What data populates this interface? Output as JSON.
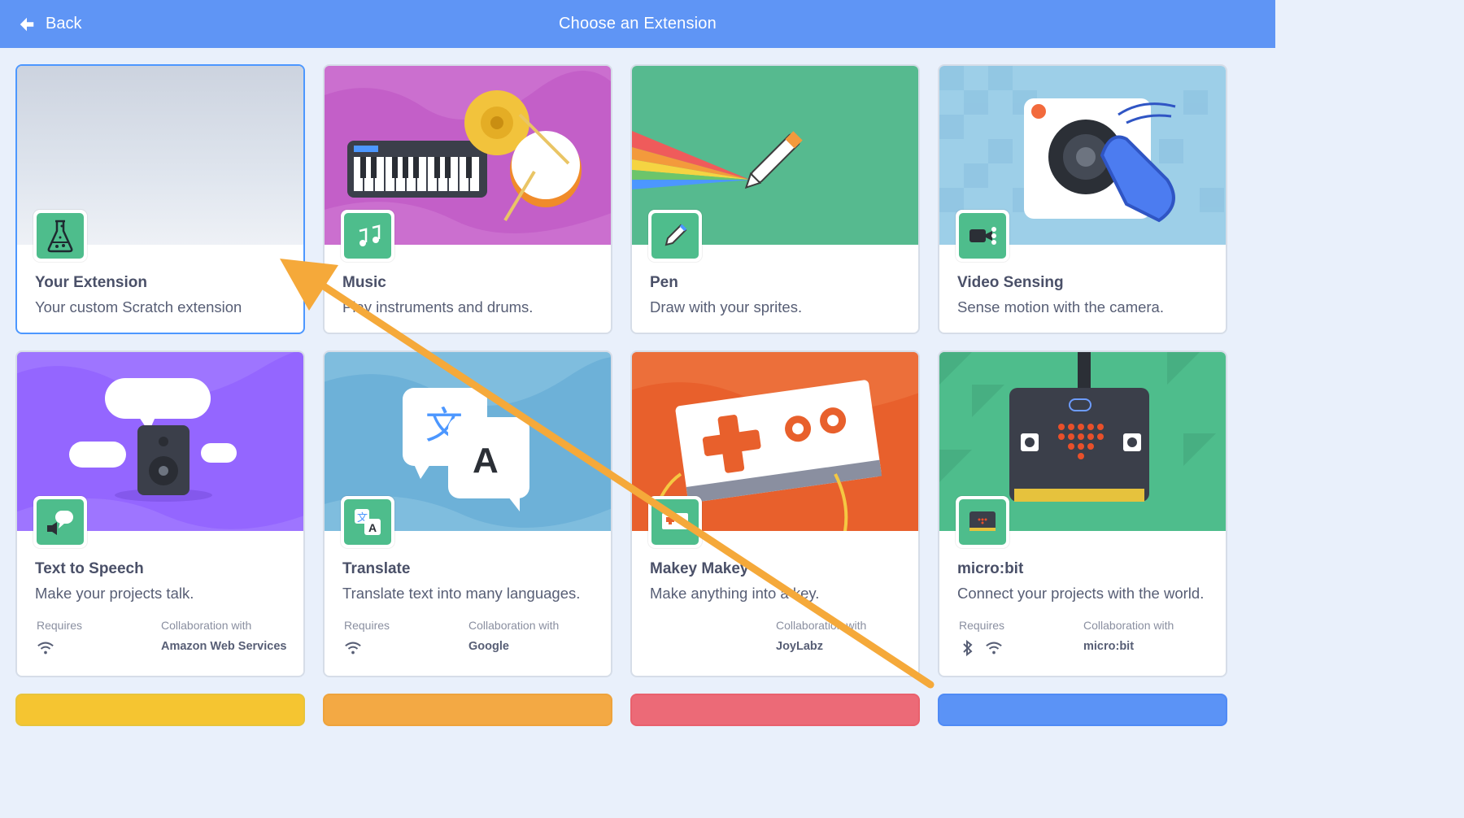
{
  "header": {
    "back_label": "Back",
    "title": "Choose an Extension"
  },
  "cards": [
    {
      "name": "Your Extension",
      "desc": "Your custom Scratch extension"
    },
    {
      "name": "Music",
      "desc": "Play instruments and drums."
    },
    {
      "name": "Pen",
      "desc": "Draw with your sprites."
    },
    {
      "name": "Video Sensing",
      "desc": "Sense motion with the camera."
    },
    {
      "name": "Text to Speech",
      "desc": "Make your projects talk.",
      "requires_label": "Requires",
      "collab_label": "Collaboration with",
      "collab": "Amazon Web Services"
    },
    {
      "name": "Translate",
      "desc": "Translate text into many languages.",
      "requires_label": "Requires",
      "collab_label": "Collaboration with",
      "collab": "Google"
    },
    {
      "name": "Makey Makey",
      "desc": "Make anything into a key.",
      "collab_label": "Collaboration with",
      "collab": "JoyLabz"
    },
    {
      "name": "micro:bit",
      "desc": "Connect your projects with the world.",
      "requires_label": "Requires",
      "collab_label": "Collaboration with",
      "collab": "micro:bit"
    }
  ],
  "colors": {
    "header": "#5f95f5",
    "badge": "#4ebd8c",
    "annotation_arrow": "#f5a93a",
    "selected_border": "#4c97ff"
  },
  "icons": {
    "back": "arrow-left-icon",
    "wifi": "wifi-icon",
    "bluetooth": "bluetooth-icon"
  }
}
